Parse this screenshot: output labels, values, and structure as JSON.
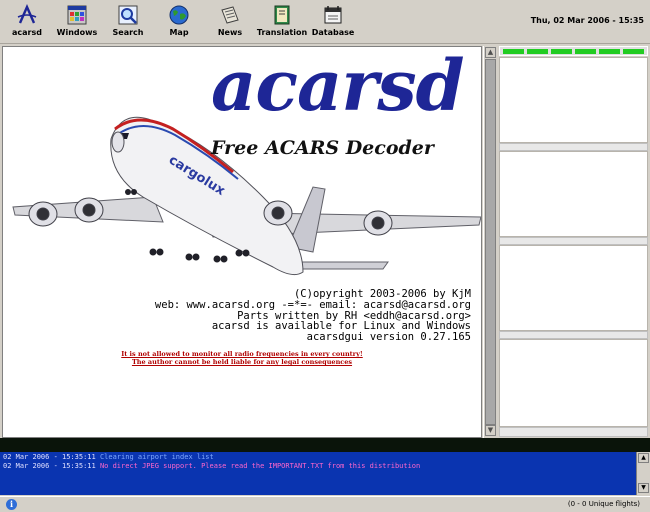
{
  "toolbar": {
    "buttons": [
      {
        "label": "acarsd",
        "icon": "acarsd-logo-icon"
      },
      {
        "label": "Windows",
        "icon": "windows-icon"
      },
      {
        "label": "Search",
        "icon": "search-icon"
      },
      {
        "label": "Map",
        "icon": "globe-icon"
      },
      {
        "label": "News",
        "icon": "newspaper-icon"
      },
      {
        "label": "Translation",
        "icon": "book-icon"
      },
      {
        "label": "Database",
        "icon": "database-icon"
      }
    ],
    "clock": "Thu, 02 Mar 2006 - 15:35"
  },
  "splash": {
    "logo": "acarsd",
    "subtitle": "Free ACARS Decoder",
    "credits": [
      "(C)opyright 2003-2006 by KjM",
      "web: www.acarsd.org -=*=- email: acarsd@acarsd.org",
      "Parts written by RH <eddh@acarsd.org>",
      "acarsd is available for Linux and Windows",
      "acarsdgui version 0.27.165"
    ],
    "warning": [
      "It is not allowed to monitor all radio frequencies in every country!",
      "The author cannot be held liable for any legal consequences"
    ]
  },
  "log": [
    {
      "timestamp": "02 Mar 2006 - 15:35:11",
      "message": "Clearing airport index list"
    },
    {
      "timestamp": "02 Mar 2006 - 15:35:11",
      "message": "No direct JPEG support. Please read the IMPORTANT.TXT from this distribution"
    }
  ],
  "statusbar": {
    "info_icon": "info-icon",
    "flights": "(0 - 0 Unique flights)"
  },
  "colors": {
    "logo_blue": "#1e2696",
    "log_background": "#0a34b0",
    "led_green": "#22cc22",
    "warning_red": "#b00000"
  }
}
